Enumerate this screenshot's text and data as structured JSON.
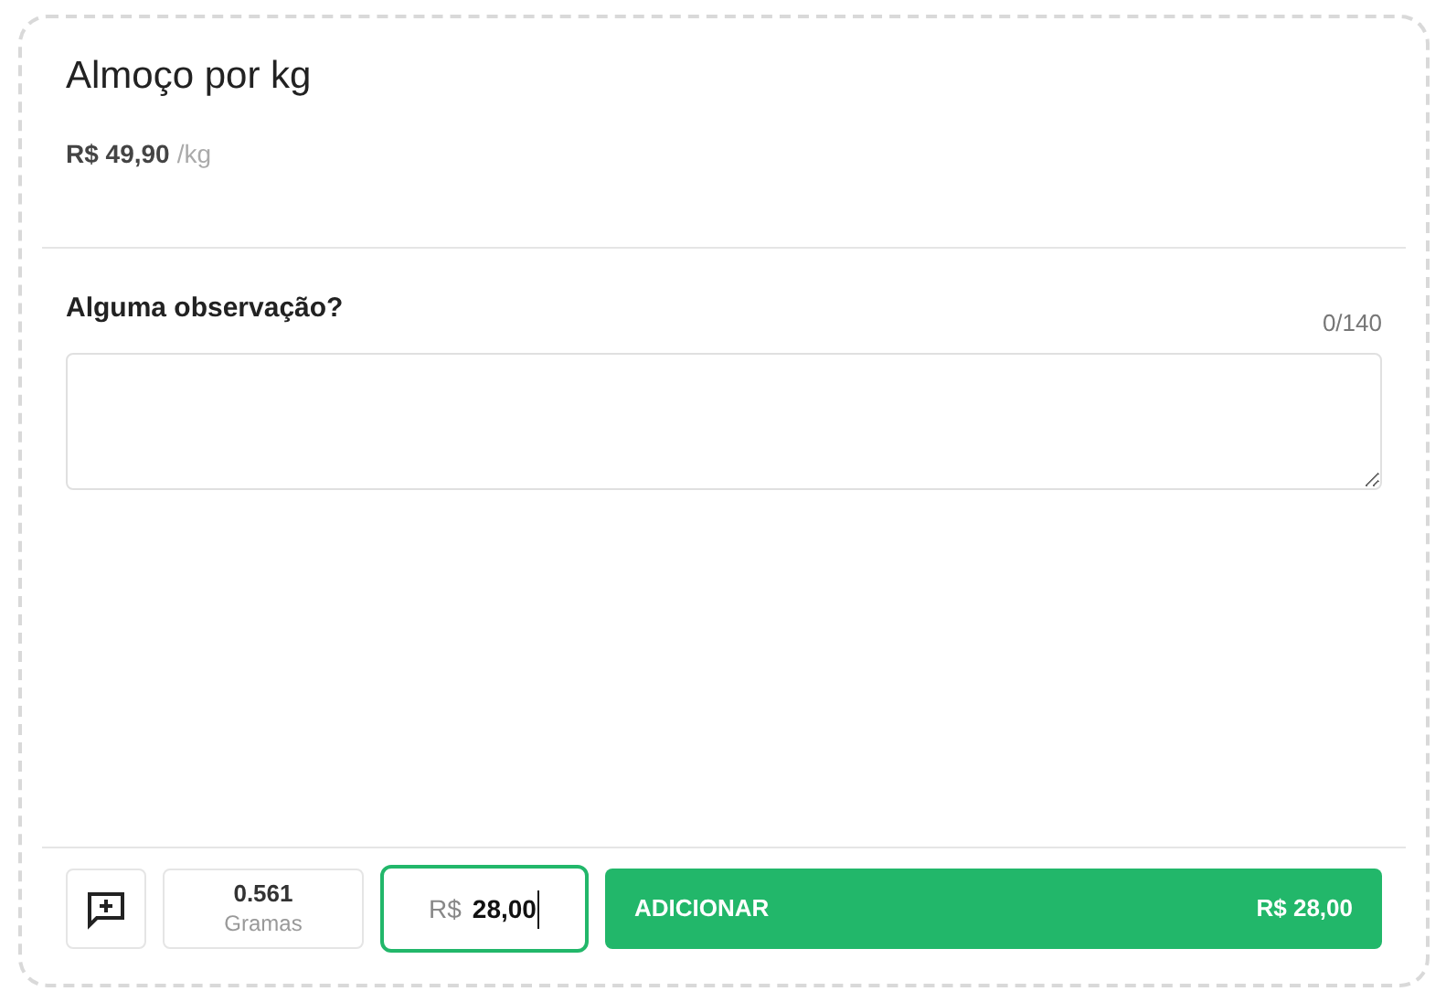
{
  "product": {
    "title": "Almoço por kg",
    "price": "R$ 49,90",
    "unit": "/kg"
  },
  "note": {
    "label": "Alguma observação?",
    "counter": "0/140"
  },
  "footer": {
    "weight": {
      "value": "0.561",
      "unit": "Gramas"
    },
    "price_field": {
      "prefix": "R$",
      "value": "28,00",
      "focused": true
    },
    "add_button": {
      "label": "ADICIONAR",
      "total": "R$ 28,00"
    }
  }
}
